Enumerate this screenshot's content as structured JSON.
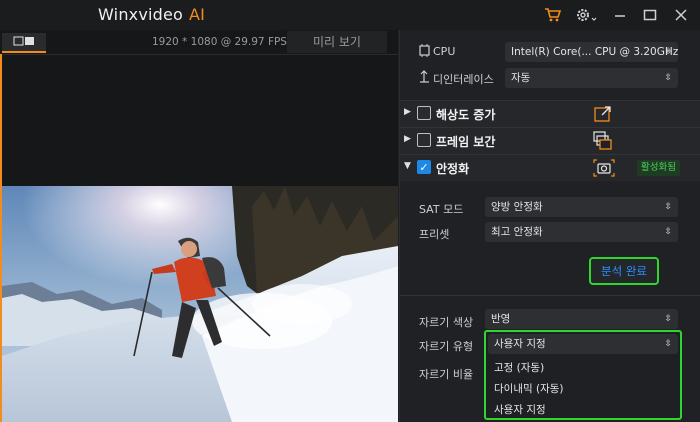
{
  "app": {
    "title": "Winxvideo",
    "title_ai": "AI"
  },
  "toolbar": {
    "icons": [
      "cart-icon",
      "gear-icon",
      "minimize-icon",
      "maximize-icon",
      "close-icon"
    ]
  },
  "preview": {
    "resolution_info": "1920 * 1080 @ 29.97 FPS",
    "preview_tab": "미리 보기"
  },
  "settings": {
    "cpu_label": "CPU",
    "cpu_value": "Intel(R) Core(... CPU @ 3.20GHz",
    "deinterlace_label": "디인터레이스",
    "deinterlace_value": "자동"
  },
  "sections": {
    "upscale": "해상도 증가",
    "frame_interp": "프레임 보간",
    "stabilize": "안정화",
    "stabilize_badge": "활성화됨"
  },
  "stabilize": {
    "sat_label": "SAT 모드",
    "sat_value": "양방 안정화",
    "preset_label": "프리셋",
    "preset_value": "최고 안정화",
    "analyze_button": "분석 완료"
  },
  "crop": {
    "color_label": "자르기 색상",
    "color_value": "반영",
    "type_label": "자르기 유형",
    "type_value": "사용자 지정",
    "ratio_label": "자르기 비율",
    "options": [
      "고정 (자동)",
      "다이내믹 (자동)",
      "사용자 지정"
    ]
  },
  "colors": {
    "accent": "#f28c1c",
    "highlight": "#2fd62f",
    "link": "#2f8cff"
  }
}
